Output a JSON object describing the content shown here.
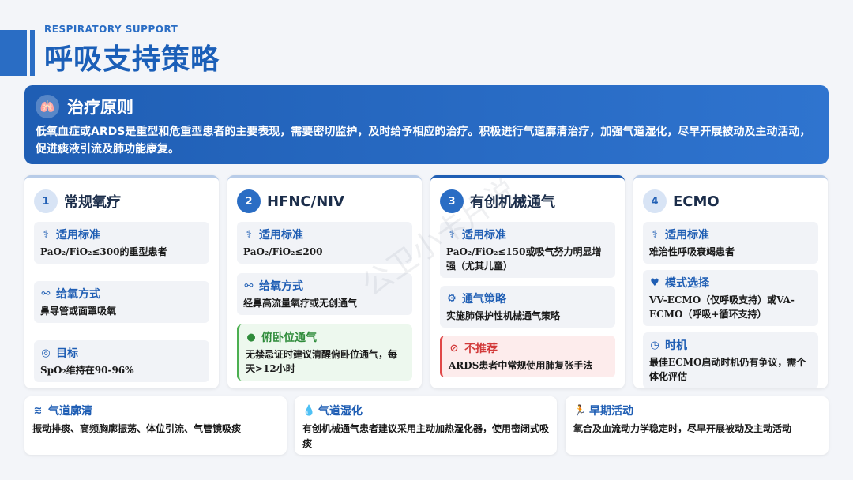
{
  "header": {
    "subtitle": "RESPIRATORY SUPPORT",
    "title": "呼吸支持策略"
  },
  "principle": {
    "icon": "lungs-icon",
    "title": "治疗原则",
    "text": "低氧血症或ARDS是重型和危重型患者的主要表现，需要密切监护，及时给予相应的治疗。积极进行气道廓清治疗，加强气道湿化，尽早开展被动及主动活动，促进痰液引流及肺功能康复。"
  },
  "cards": [
    {
      "num": "1",
      "title": "常规氧疗",
      "sections": [
        {
          "icon": "stethoscope-icon",
          "label": "适用标准",
          "text": "PaO₂/FiO₂≤300的重型患者"
        },
        {
          "icon": "link-icon",
          "label": "给氧方式",
          "text": "鼻导管或面罩吸氧"
        },
        {
          "icon": "target-icon",
          "label": "目标",
          "text": "SpO₂维持在90-96%"
        }
      ]
    },
    {
      "num": "2",
      "title": "HFNC/NIV",
      "sections": [
        {
          "icon": "stethoscope-icon",
          "label": "适用标准",
          "text": "PaO₂/FiO₂≤200"
        },
        {
          "icon": "link-icon",
          "label": "给氧方式",
          "text": "经鼻高流量氧疗或无创通气"
        },
        {
          "icon": "bulb-icon",
          "label": "俯卧位通气",
          "text": "无禁忌证时建议清醒俯卧位通气，每天>12小时"
        }
      ]
    },
    {
      "num": "3",
      "title": "有创机械通气",
      "sections": [
        {
          "icon": "stethoscope-icon",
          "label": "适用标准",
          "text": "PaO₂/FiO₂≤150或吸气努力明显增强（尤其儿童）"
        },
        {
          "icon": "gear-icon",
          "label": "通气策略",
          "text": "实施肺保护性机械通气策略"
        },
        {
          "icon": "ban-icon",
          "label": "不推荐",
          "text": "ARDS患者中常规使用肺复张手法"
        }
      ]
    },
    {
      "num": "4",
      "title": "ECMO",
      "sections": [
        {
          "icon": "stethoscope-icon",
          "label": "适用标准",
          "text": "难治性呼吸衰竭患者"
        },
        {
          "icon": "heartbeat-icon",
          "label": "模式选择",
          "text": "VV-ECMO（仅呼吸支持）或VA-ECMO（呼吸+循环支持）"
        },
        {
          "icon": "clock-icon",
          "label": "时机",
          "text": "最佳ECMO启动时机仍有争议，需个体化评估"
        }
      ]
    }
  ],
  "bottom": [
    {
      "icon": "wind-icon",
      "label": "气道廓清",
      "text": "振动排痰、高频胸廓振荡、体位引流、气管镜吸痰"
    },
    {
      "icon": "droplet-icon",
      "label": "气道湿化",
      "text": "有创机械通气患者建议采用主动加热湿化器，使用密闭式吸痰"
    },
    {
      "icon": "running-icon",
      "label": "早期活动",
      "text": "氧合及血流动力学稳定时，尽早开展被动及主动活动"
    }
  ],
  "watermark": "公卫小卡片说"
}
